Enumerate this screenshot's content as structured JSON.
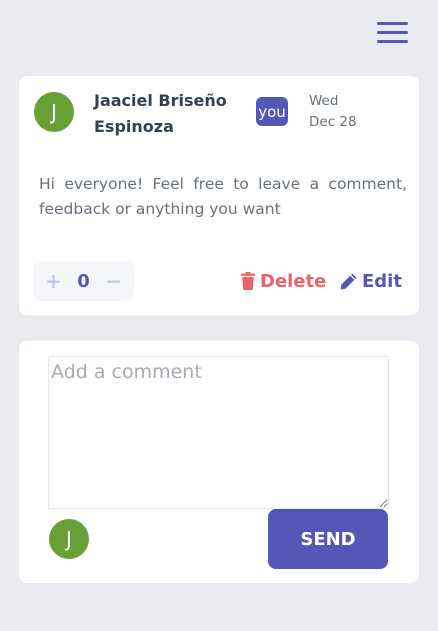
{
  "header": {
    "menu_icon": "hamburger-menu-icon"
  },
  "comment": {
    "avatar_initial": "J",
    "username": "Jaaciel Briseño Espinoza",
    "you_badge": "you",
    "date_day": "Wed",
    "date_month_day": "Dec 28",
    "content": "Hi everyone! Feel free to leave a comment, feedback or anything you want",
    "vote": {
      "plus": "+",
      "count": "0",
      "minus": "−"
    },
    "delete_label": "Delete",
    "delete_icon": "trash-icon",
    "edit_label": "Edit",
    "edit_icon": "pencil-icon"
  },
  "reply": {
    "placeholder": "Add a comment",
    "value": "",
    "avatar_initial": "J",
    "send_label": "SEND"
  },
  "colors": {
    "background": "#e9ebf0",
    "accent": "#5457b6",
    "danger": "#ed6368",
    "avatar": "#68a038",
    "text_dark": "#334253",
    "text_muted": "#67727e"
  }
}
